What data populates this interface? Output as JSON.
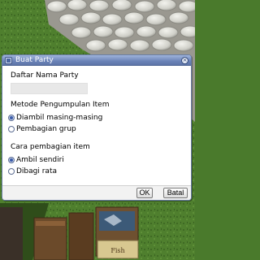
{
  "dialog": {
    "title": "Buat Party",
    "party_name_label": "Daftar Nama Party",
    "party_name_value": "",
    "item_method_label": "Metode Pengumpulan Item",
    "item_method_options": [
      "Diambil masing-masing",
      "Pembagian grup"
    ],
    "item_method_selected": "Diambil masing-masing",
    "share_method_label": "Cara pembagian item",
    "share_method_options": [
      "Ambil sendiri",
      "Dibagi rata"
    ],
    "share_method_selected": "Ambil sendiri",
    "ok_label": "OK",
    "cancel_label": "Batal"
  },
  "scene": {
    "sign_text": "Fish"
  },
  "colors": {
    "titlebar": "#6b83b8",
    "grass": "#4a7a2c",
    "cobblestone": "#d8d8d0"
  }
}
